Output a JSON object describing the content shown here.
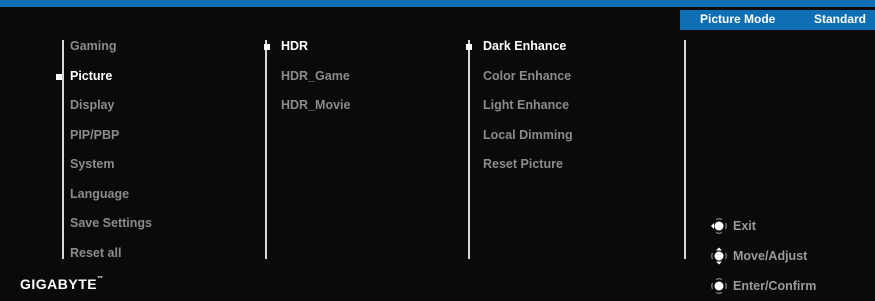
{
  "header": {
    "mode_label": "Picture Mode",
    "mode_value": "Standard"
  },
  "menu": {
    "level1": [
      "Gaming",
      "Picture",
      "Display",
      "PIP/PBP",
      "System",
      "Language",
      "Save Settings",
      "Reset all"
    ],
    "level1_active": "Picture",
    "level2": [
      "HDR",
      "HDR_Game",
      "HDR_Movie"
    ],
    "level2_active": "HDR",
    "level3": [
      "Dark Enhance",
      "Color Enhance",
      "Light Enhance",
      "Local Dimming",
      "Reset Picture"
    ],
    "level3_active": "Dark Enhance"
  },
  "brand": {
    "logo": "GIGABYTE",
    "trademark": "™"
  },
  "hints": [
    {
      "icon": "joystick-left-icon",
      "label": "Exit"
    },
    {
      "icon": "joystick-updown-icon",
      "label": "Move/Adjust"
    },
    {
      "icon": "joystick-press-icon",
      "label": "Enter/Confirm"
    }
  ],
  "colors": {
    "accent": "#0f6fb5",
    "active_text": "#ffffff",
    "inactive_text": "#8b8b8b"
  }
}
